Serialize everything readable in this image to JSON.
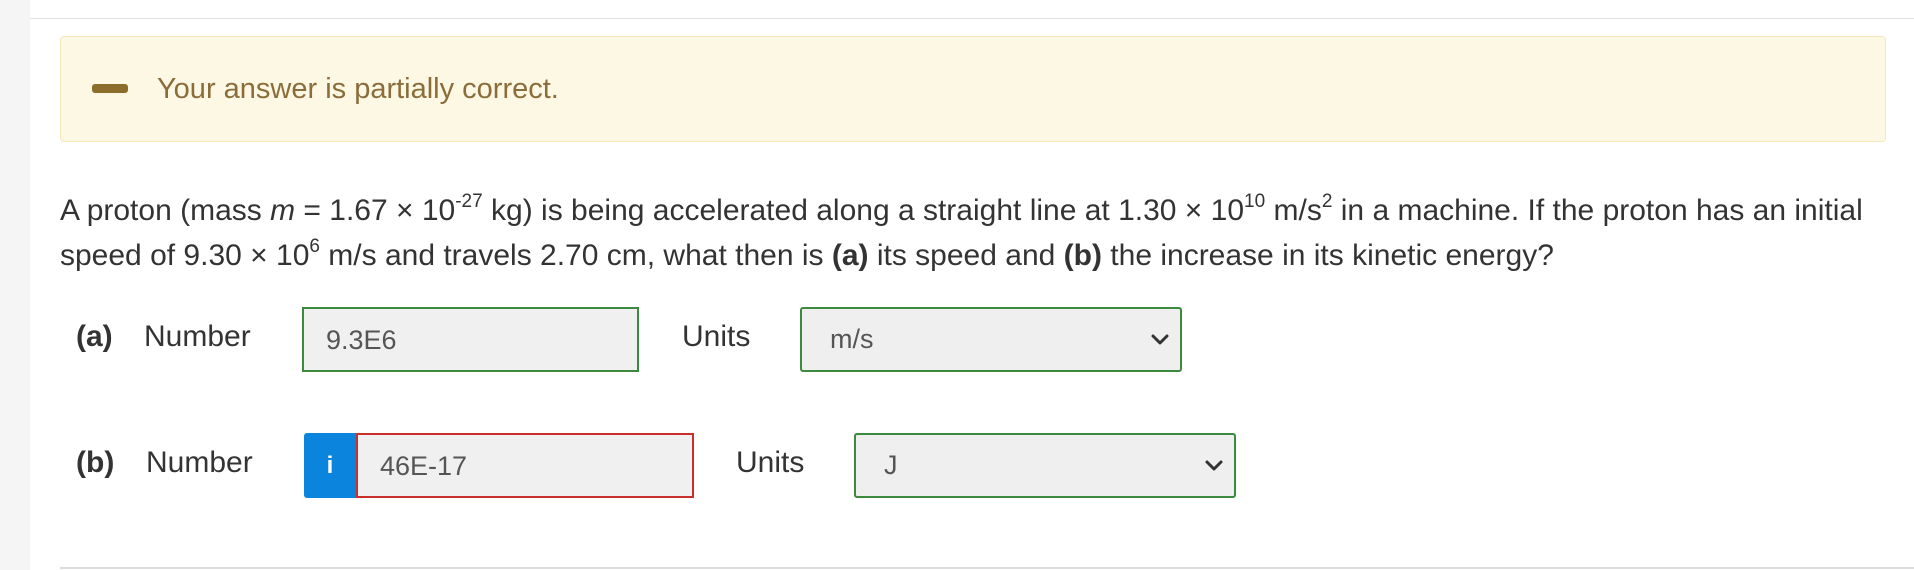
{
  "feedback": {
    "message": "Your answer is partially correct.",
    "colors": {
      "background": "#fdf8e3",
      "text": "#8a6d3b",
      "icon": "#8c6d2c"
    },
    "icon": "minus-icon"
  },
  "question": {
    "intro": "A proton (mass ",
    "mass_symbol": "m",
    "mass_value": " = 1.67 × 10",
    "mass_exp": "-27",
    "mass_unit": " kg) is being accelerated along a straight line at 1.30 × 10",
    "accel_exp": "10",
    "accel_unit": " m/s",
    "accel_unit_exp": "2",
    "mid": " in a machine. If the proton has an initial speed of 9.30 × 10",
    "speed_exp": "6",
    "tail1": " m/s and travels 2.70 cm, what then is ",
    "part_a_tag": "(a)",
    "tail2": " its speed and ",
    "part_b_tag": "(b)",
    "tail3": " the increase in its kinetic energy?"
  },
  "parts": [
    {
      "label": "(a)",
      "number_label": "Number",
      "number_value": "9.3E6",
      "number_status": "correct",
      "units_label": "Units",
      "units_value": "m/s",
      "units_status": "correct"
    },
    {
      "label": "(b)",
      "number_label": "Number",
      "info_icon": "info-icon",
      "info_glyph": "i",
      "number_value": "46E-17",
      "number_status": "incorrect",
      "units_label": "Units",
      "units_value": "J",
      "units_status": "correct"
    }
  ],
  "colors": {
    "correct_border": "#3b8a3e",
    "incorrect_border": "#c9302c",
    "info_button": "#0b84de"
  }
}
